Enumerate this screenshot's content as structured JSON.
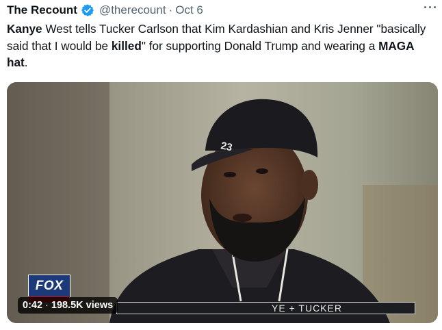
{
  "tweet": {
    "author_name": "The Recount",
    "handle": "@therecount",
    "separator": "·",
    "date": "Oct 6",
    "more_icon": "more-icon",
    "text_parts": [
      {
        "text": "Kanye",
        "bold": true
      },
      {
        "text": " West tells Tucker Carlson that Kim Kardashian and Kris Jenner \"basically said that I would be ",
        "bold": false
      },
      {
        "text": "killed",
        "bold": true
      },
      {
        "text": "\" for supporting Donald Trump and wearing a ",
        "bold": false
      },
      {
        "text": "MAGA hat",
        "bold": true
      },
      {
        "text": ".",
        "bold": false
      }
    ]
  },
  "video": {
    "time": "0:42",
    "separator": "·",
    "views": "198.5K views",
    "channel_logo_text": "FOX",
    "lower_third_text": "YE + TUCKER",
    "cap_text": "23"
  },
  "colors": {
    "verified_blue": "#1d9bf0",
    "muted_text": "#536471",
    "fox_blue": "#1c3a7a",
    "fox_red": "#c4141b"
  }
}
